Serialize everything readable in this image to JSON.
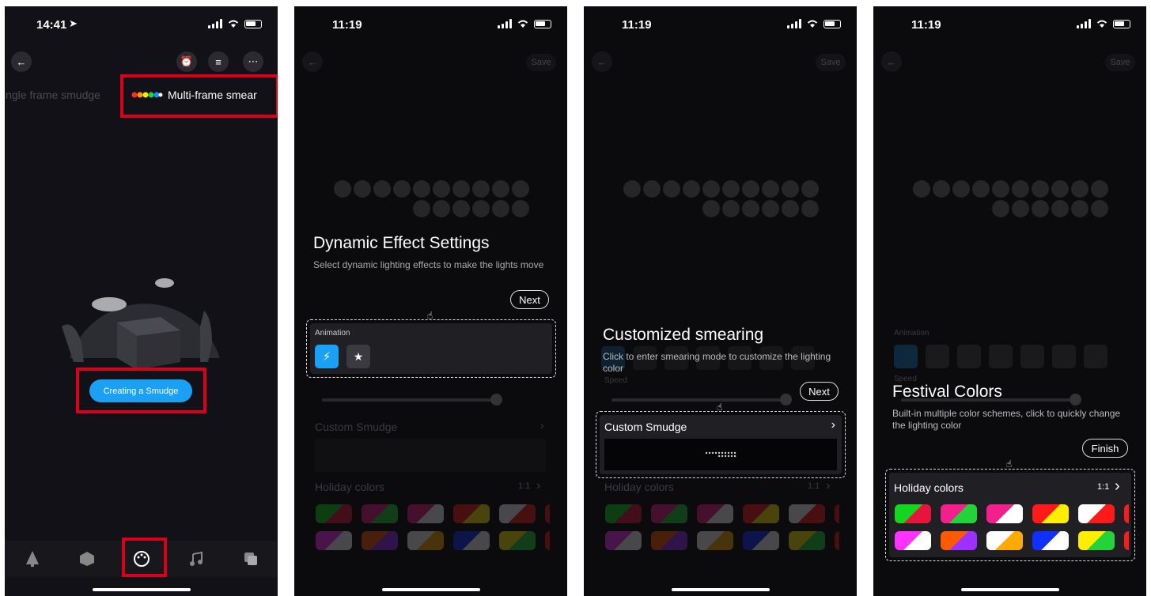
{
  "screens": {
    "p1": {
      "time": "14:41",
      "tab_single": "ingle frame smudge",
      "tab_multi": "Multi-frame smear",
      "create_button": "Creating a Smudge",
      "icons": [
        "back-arrow-icon",
        "alarm-icon",
        "playlist-icon",
        "more-icon",
        "tree-icon",
        "cube-icon",
        "palette-icon",
        "music-icon",
        "copy-icon"
      ]
    },
    "p2": {
      "time": "11:19",
      "save": "Save",
      "title": "Dynamic Effect Settings",
      "subtitle": "Select dynamic lighting effects to make the lights move",
      "next": "Next",
      "animation_label": "Animation",
      "custom_smudge": "Custom Smudge",
      "holiday_colors": "Holiday colors",
      "ratio": "1:1"
    },
    "p3": {
      "time": "11:19",
      "save": "Save",
      "title": "Customized smearing",
      "subtitle": "Click to enter smearing mode to customize the lighting color",
      "next": "Next",
      "speed_label": "Speed",
      "custom_smudge": "Custom Smudge",
      "holiday_colors": "Holiday colors",
      "ratio": "1:1"
    },
    "p4": {
      "time": "11:19",
      "save": "Save",
      "animation_label": "Animation",
      "speed_label": "Speed",
      "title": "Festival Colors",
      "subtitle": "Built-in multiple color schemes, click to quickly change the lighting color",
      "finish": "Finish",
      "holiday_colors": "Holiday colors",
      "ratio": "1:1"
    }
  },
  "colors": {
    "accent_blue": "#1aa0f5",
    "highlight_red": "#d9001b"
  },
  "swatches": {
    "row1": [
      [
        "#12d61f",
        "#e8153b"
      ],
      [
        "#f21f8c",
        "#22d43a"
      ],
      [
        "#f21f8c",
        "#ffffff"
      ],
      [
        "#ff1a1a",
        "#ffee00"
      ],
      [
        "#ffffff",
        "#ff1a1a"
      ]
    ],
    "row2": [
      [
        "#ff33ff",
        "#ffffff"
      ],
      [
        "#ff5a00",
        "#9b30ff"
      ],
      [
        "#ffffff",
        "#ffaa00"
      ],
      [
        "#1030ff",
        "#ffffff"
      ],
      [
        "#ffee00",
        "#22d43a"
      ]
    ]
  }
}
